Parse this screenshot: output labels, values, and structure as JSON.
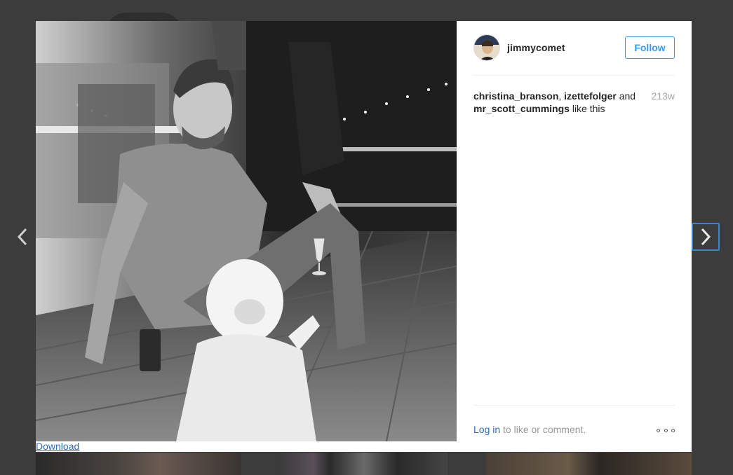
{
  "post": {
    "username": "jimmycomet",
    "follow_label": "Follow",
    "timestamp": "213w",
    "likes": {
      "users": [
        "christina_branson",
        "izettefolger",
        "mr_scott_cummings"
      ],
      "separator": ",",
      "and_word": "and",
      "suffix": "like this"
    },
    "footer": {
      "login_link": "Log in",
      "login_suffix": "to like or comment."
    },
    "download_label": "Download"
  },
  "icons": {
    "prev": "chevron-left-icon",
    "next": "chevron-right-icon",
    "more": "more-options-icon"
  },
  "colors": {
    "accent": "#3897f0",
    "link": "#2f6db6",
    "overlay": "#3e3e3e",
    "muted": "#a5a7aa"
  }
}
